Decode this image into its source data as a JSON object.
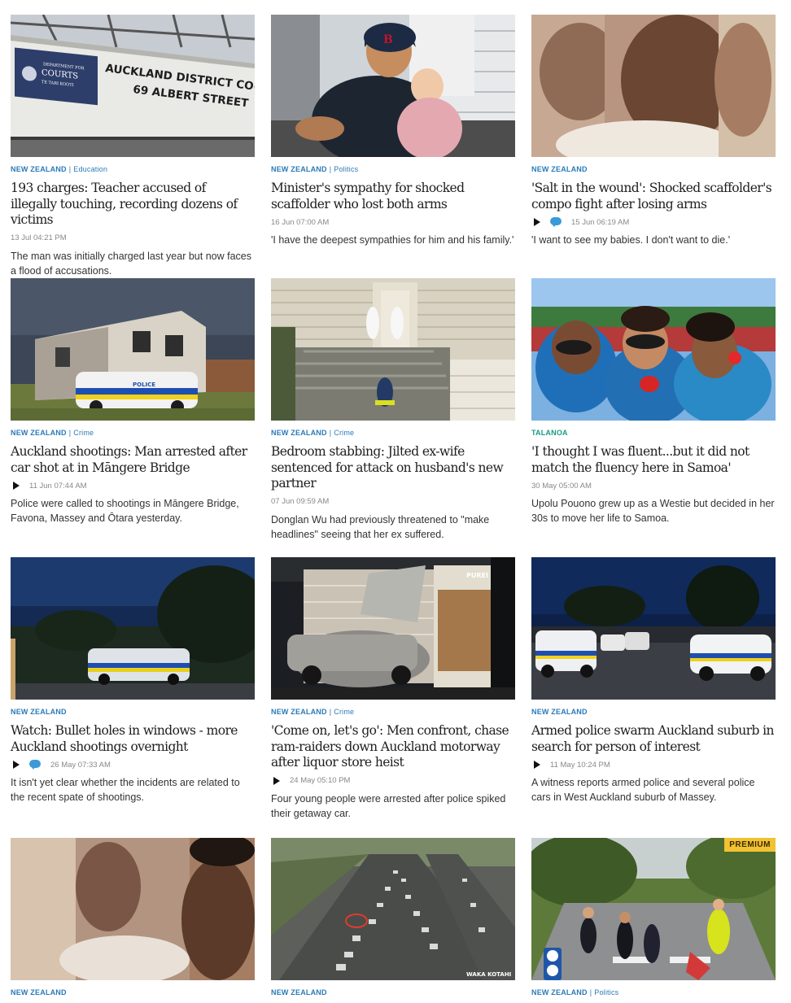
{
  "cards": [
    {
      "kicker": "NEW ZEALAND",
      "sub": "Education",
      "headline": "193 charges: Teacher accused of illegally touching, recording dozens of victims",
      "time": "13 Jul 04:21 PM",
      "summary": "The man was initially charged last year but now faces a flood of accusations.",
      "image": "court-sign"
    },
    {
      "kicker": "NEW ZEALAND",
      "sub": "Politics",
      "headline": "Minister's sympathy for shocked scaffolder who lost both arms",
      "time": "16 Jun 07:00 AM",
      "summary": "'I have the deepest sympathies for him and his family.'",
      "image": "man-and-baby"
    },
    {
      "kicker": "NEW ZEALAND",
      "sub": "",
      "headline": "'Salt in the wound': Shocked scaffolder's compo fight after losing arms",
      "time": "15 Jun 06:19 AM",
      "summary": "'I want to see my babies. I don't want to die.'",
      "image": "scaffolder-closeup"
    },
    {
      "kicker": "NEW ZEALAND",
      "sub": "Crime",
      "headline": "Auckland shootings: Man arrested after car shot at in Māngere Bridge",
      "time": "11 Jun 07:44 AM",
      "summary": "Police were called to shootings in Māngere Bridge, Favona, Massey and Ōtara yesterday.",
      "image": "police-car-house"
    },
    {
      "kicker": "NEW ZEALAND",
      "sub": "Crime",
      "headline": "Bedroom stabbing: Jilted ex-wife sentenced for attack on husband's new partner",
      "time": "07 Jun 09:59 AM",
      "summary": "Donglan Wu had previously threatened to \"make headlines\" seeing that her ex suffered.",
      "image": "forensic-house"
    },
    {
      "kicker": "TALANOA",
      "sub": "",
      "headline": "'I thought I was fluent...but it did not match the fluency here in Samoa'",
      "time": "30 May 05:00 AM",
      "summary": "Upolu Pouono grew up as a Westie but decided in her 30s to move her life to Samoa.",
      "image": "selfie-samoa"
    },
    {
      "kicker": "NEW ZEALAND",
      "sub": "",
      "headline": "Watch: Bullet holes in windows - more Auckland shootings overnight",
      "time": "26 May 07:33 AM",
      "summary": "It isn't yet clear whether the incidents are related to the recent spate of shootings.",
      "image": "police-car-night"
    },
    {
      "kicker": "NEW ZEALAND",
      "sub": "Crime",
      "headline": "'Come on, let's go': Men confront, chase ram-raiders down Auckland motorway after liquor store heist",
      "time": "24 May 05:10 PM",
      "summary": "Four young people were arrested after police spiked their getaway car.",
      "image": "ram-raid-store"
    },
    {
      "kicker": "NEW ZEALAND",
      "sub": "",
      "headline": "Armed police swarm Auckland suburb in search for person of interest",
      "time": "11 May 10:24 PM",
      "summary": "A witness reports armed police and several police cars in West Auckland suburb of Massey.",
      "image": "police-cars-street"
    },
    {
      "kicker": "NEW ZEALAND",
      "sub": "",
      "headline": "",
      "time": "",
      "summary": "",
      "image": "scaffolder-closeup"
    },
    {
      "kicker": "NEW ZEALAND",
      "sub": "",
      "headline": "",
      "time": "",
      "summary": "",
      "image": "motorway-traffic",
      "watermark": "WAKA KOTAHI"
    },
    {
      "kicker": "NEW ZEALAND",
      "sub": "Politics",
      "headline": "",
      "time": "",
      "summary": "",
      "image": "school-crossing",
      "badge": "PREMIUM"
    }
  ],
  "colors": {
    "kicker": "#2a7ab8",
    "talanoa": "#1a9a86",
    "comment": "#3a9ad9",
    "premium": "#f1c232"
  },
  "court_sign": {
    "line1": "AUCKLAND DISTRICT COURT",
    "line2": "69 ALBERT STREET",
    "badge1": "DEPARTMENT FOR",
    "badge2": "COURTS",
    "badge3": "TE TARI KOOTI"
  },
  "store_sign": "PUREI",
  "police_label": "POLICE"
}
